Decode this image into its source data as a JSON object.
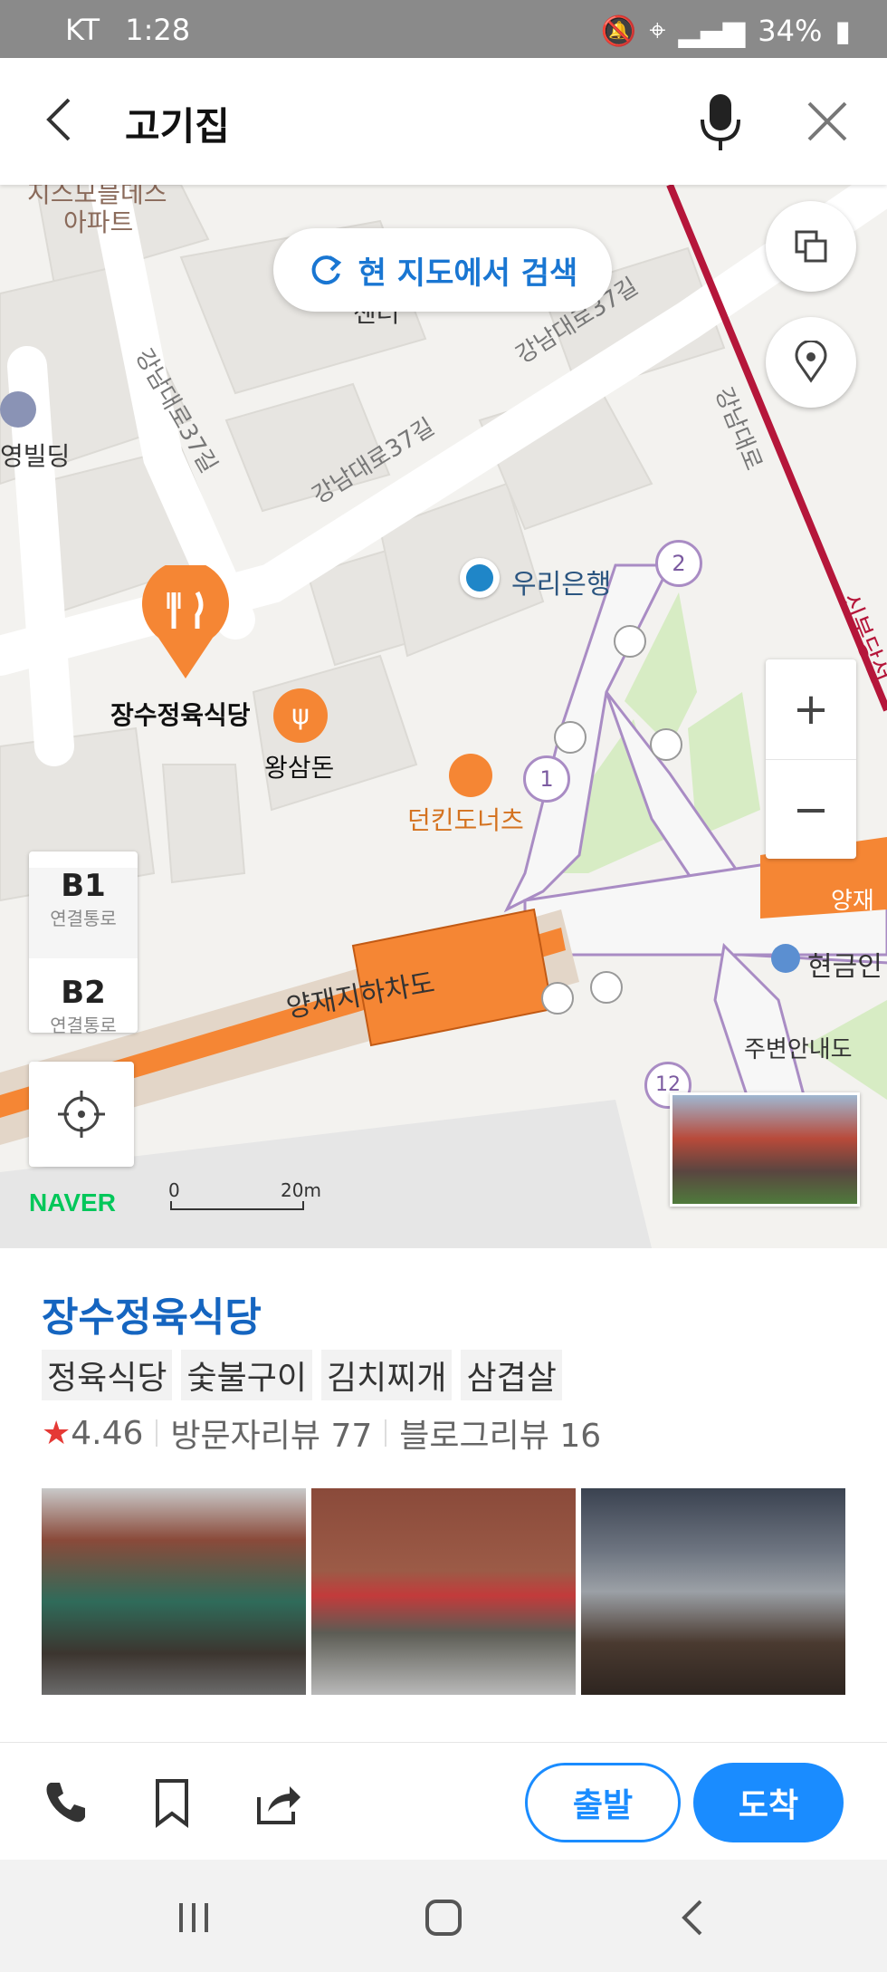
{
  "status_bar": {
    "carrier": "KT",
    "time": "1:28",
    "battery": "34%"
  },
  "search": {
    "query": "고기집"
  },
  "map": {
    "research_button": "현 지도에서 검색",
    "labels": {
      "apartment": "아파트",
      "apartment_top": "지스모블데스",
      "center": "센터",
      "building": "영빌딩",
      "bank": "우리은행",
      "restaurant_main": "장수정육식당",
      "restaurant_2": "왕삼돈",
      "donut": "던킨도너츠",
      "underpass": "양재지하차도",
      "info": "주변안내도",
      "atm": "현금인",
      "subway_line": "신분당선",
      "yang": "양재"
    },
    "roads": {
      "road_37_a": "강남대로37길",
      "road_37_b": "강남대로37길",
      "road_37_c": "강남대로37길",
      "gangnam": "강남대로"
    },
    "exits": [
      "1",
      "2",
      "12"
    ],
    "floors": [
      {
        "level": "B1",
        "label": "연결통로"
      },
      {
        "level": "B2",
        "label": "연결통로"
      }
    ],
    "zoom_in": "+",
    "zoom_out": "−",
    "logo": "NAVER",
    "scale": {
      "zero": "0",
      "distance": "20m"
    }
  },
  "place": {
    "name": "장수정육식당",
    "tags": [
      "정육식당",
      "숯불구이",
      "김치찌개",
      "삼겹살"
    ],
    "star": "★",
    "rating": "4.46",
    "visitor_reviews": "방문자리뷰 77",
    "blog_reviews": "블로그리뷰 16"
  },
  "actions": {
    "depart": "출발",
    "arrive": "도착"
  },
  "colors": {
    "accent": "#1a8cff",
    "name_blue": "#1565c0",
    "pin_orange": "#f58634",
    "star_red": "#e53935",
    "line_red": "#b5163a",
    "naver_green": "#03c75a"
  }
}
